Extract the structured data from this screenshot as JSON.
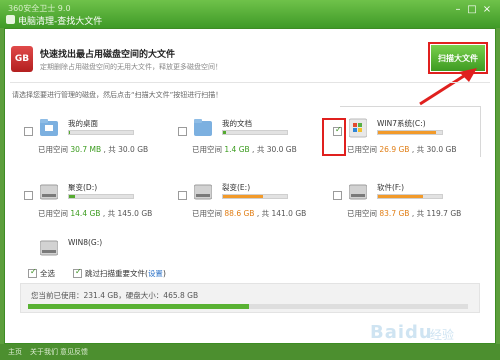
{
  "window": {
    "app_title": "360安全卫士 9.0",
    "dialog_title": "电脑清理-查找大文件",
    "controls": [
      "–",
      "□",
      "×"
    ]
  },
  "header": {
    "icon_label": "GB",
    "title": "快速找出最占用磁盘空间的大文件",
    "description": "定期删除占用磁盘空间的无用大文件，释放更多磁盘空间！",
    "scan_button": "扫描大文件"
  },
  "instruction": "请选择您要进行管理的磁盘，然后点击“扫描大文件”按钮进行扫描！",
  "disks": [
    {
      "name": "我的桌面",
      "used_label": "已用空间",
      "used": "30.7 MB",
      "total_label": "共 30.0 GB",
      "fill": 0.02,
      "checked": false,
      "icon": "desktop-folder-icon",
      "color": "green"
    },
    {
      "name": "我的文档",
      "used_label": "已用空间",
      "used": "1.4 GB",
      "total_label": "共 30.0 GB",
      "fill": 0.05,
      "checked": false,
      "icon": "documents-folder-icon",
      "color": "green"
    },
    {
      "name": "WIN7系统(C:)",
      "used_label": "已用空间",
      "used": "26.9 GB",
      "total_label": "共 30.0 GB",
      "fill": 0.9,
      "checked": true,
      "icon": "windows-drive-icon",
      "color": "orange"
    },
    {
      "name": "聚变(D:)",
      "used_label": "已用空间",
      "used": "14.4 GB",
      "total_label": "共 145.0 GB",
      "fill": 0.1,
      "checked": false,
      "icon": "hard-drive-icon",
      "color": "green"
    },
    {
      "name": "裂变(E:)",
      "used_label": "已用空间",
      "used": "88.6 GB",
      "total_label": "共 141.0 GB",
      "fill": 0.63,
      "checked": false,
      "icon": "hard-drive-icon",
      "color": "orange"
    },
    {
      "name": "软件(F:)",
      "used_label": "已用空间",
      "used": "83.7 GB",
      "total_label": "共 119.7 GB",
      "fill": 0.7,
      "checked": false,
      "icon": "hard-drive-icon",
      "color": "orange"
    },
    {
      "name": "WIN8(G:)",
      "icon": "hard-drive-icon",
      "checked": false
    }
  ],
  "options": {
    "select_all": "全选",
    "skip_important": "跳过扫描重要文件(",
    "settings_link": "设置",
    "settings_close": ")"
  },
  "summary": {
    "text": "您当前已使用：231.4 GB，硬盘大小：465.8 GB",
    "fill": 0.497
  },
  "statusbar": {
    "items": [
      "主页",
      "关于我们",
      "意见反馈"
    ]
  },
  "watermark": {
    "logo": "Baidu",
    "suffix": "经验"
  },
  "colors": {
    "accent": "#3e9b22",
    "highlight": "#e0201e",
    "used_green": "#3b9b1e",
    "used_orange": "#e07d14"
  }
}
